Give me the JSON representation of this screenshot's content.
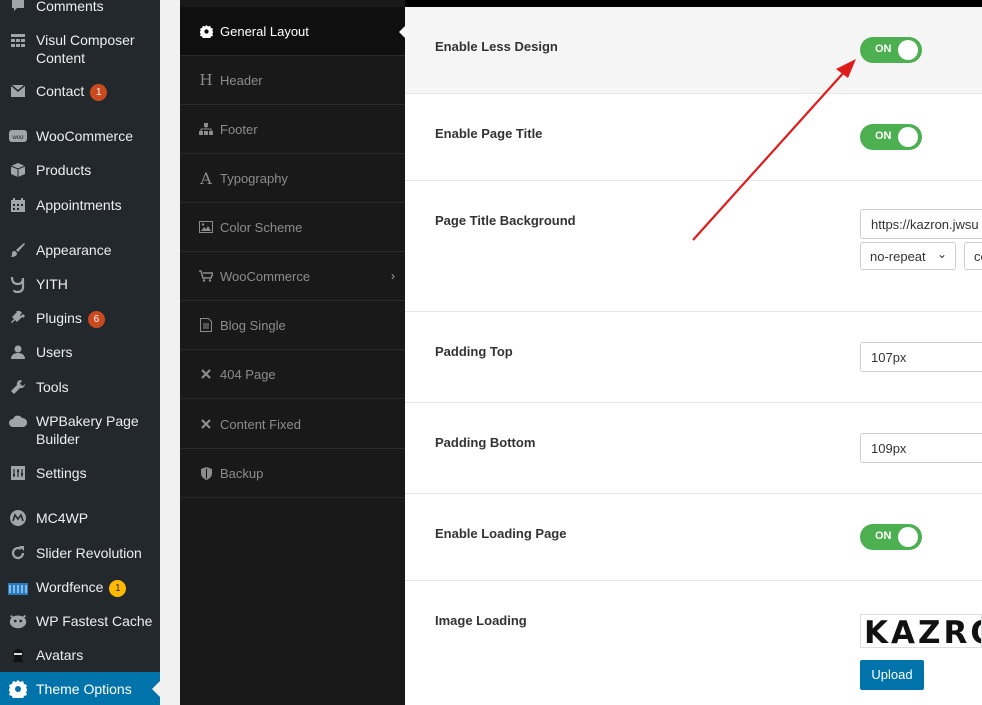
{
  "wp_menu": [
    {
      "label": "Comments",
      "icon": "comments-icon"
    },
    {
      "label": "Visul Composer Content",
      "icon": "grid-icon"
    },
    {
      "label": "Contact",
      "icon": "mail-icon",
      "badge": "1"
    },
    {
      "label": "WooCommerce",
      "icon": "woocommerce-icon"
    },
    {
      "label": "Products",
      "icon": "box-icon"
    },
    {
      "label": "Appointments",
      "icon": "calendar-icon"
    },
    {
      "label": "Appearance",
      "icon": "brush-icon"
    },
    {
      "label": "YITH",
      "icon": "yith-icon"
    },
    {
      "label": "Plugins",
      "icon": "plug-icon",
      "badge": "6"
    },
    {
      "label": "Users",
      "icon": "user-icon"
    },
    {
      "label": "Tools",
      "icon": "wrench-icon"
    },
    {
      "label": "WPBakery Page Builder",
      "icon": "cloud-icon"
    },
    {
      "label": "Settings",
      "icon": "settings-sliders-icon"
    },
    {
      "label": "MC4WP",
      "icon": "mc4wp-icon"
    },
    {
      "label": "Slider Revolution",
      "icon": "refresh-icon"
    },
    {
      "label": "Wordfence",
      "icon": "wordfence-icon",
      "badge": "1"
    },
    {
      "label": "WP Fastest Cache",
      "icon": "cheetah-icon"
    },
    {
      "label": "Avatars",
      "icon": "ninja-icon"
    },
    {
      "label": "Theme Options",
      "icon": "gear-icon"
    }
  ],
  "theme_nav": [
    {
      "label": "General Layout",
      "icon": "gear-icon"
    },
    {
      "label": "Header",
      "icon": "header-h-icon"
    },
    {
      "label": "Footer",
      "icon": "sitemap-icon"
    },
    {
      "label": "Typography",
      "icon": "font-a-icon"
    },
    {
      "label": "Color Scheme",
      "icon": "image-icon"
    },
    {
      "label": "WooCommerce",
      "icon": "cart-icon"
    },
    {
      "label": "Blog Single",
      "icon": "document-icon"
    },
    {
      "label": "404 Page",
      "icon": "times-icon"
    },
    {
      "label": "Content Fixed",
      "icon": "times-icon"
    },
    {
      "label": "Backup",
      "icon": "shield-icon"
    }
  ],
  "settings": {
    "enable_less_design": {
      "label": "Enable Less Design",
      "value": "ON"
    },
    "enable_page_title": {
      "label": "Enable Page Title",
      "value": "ON"
    },
    "page_title_background": {
      "label": "Page Title Background",
      "url": "https://kazron.jwsu",
      "repeat": "no-repeat",
      "second": "co"
    },
    "padding_top": {
      "label": "Padding Top",
      "value": "107px"
    },
    "padding_bottom": {
      "label": "Padding Bottom",
      "value": "109px"
    },
    "enable_loading_page": {
      "label": "Enable Loading Page",
      "value": "ON"
    },
    "image_loading": {
      "label": "Image Loading",
      "logo_text": "KAZRON",
      "upload_label": "Upload"
    }
  },
  "colors": {
    "toggle_on": "#4caf50",
    "upload_button": "#0073aa",
    "annotation_arrow": "#e01b1b",
    "wp_active": "#0073aa"
  }
}
